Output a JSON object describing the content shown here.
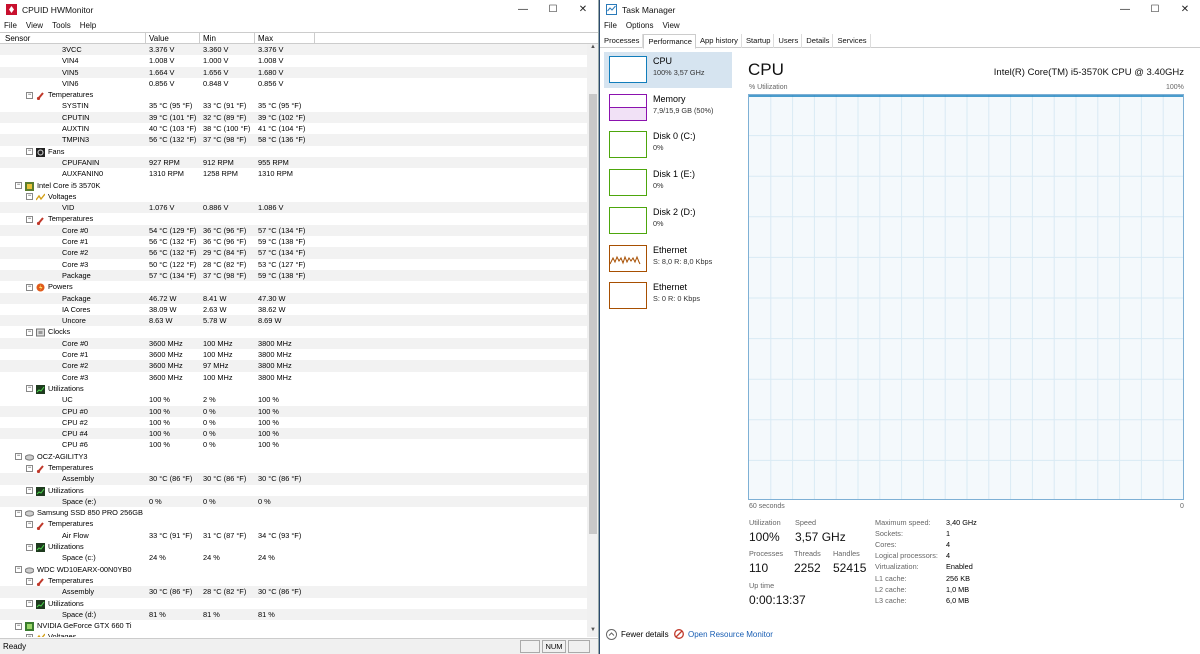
{
  "hwmonitor": {
    "title": "CPUID HWMonitor",
    "menu": [
      "File",
      "View",
      "Tools",
      "Help"
    ],
    "columns": {
      "sensor": "Sensor",
      "value": "Value",
      "min": "Min",
      "max": "Max"
    },
    "status": "Ready",
    "num": "NUM",
    "rows": [
      {
        "t": "leaf",
        "i": 3,
        "n": "3VCC",
        "v": "3.376 V",
        "mn": "3.360 V",
        "mx": "3.376 V"
      },
      {
        "t": "leaf",
        "i": 3,
        "n": "VIN4",
        "v": "1.008 V",
        "mn": "1.000 V",
        "mx": "1.008 V"
      },
      {
        "t": "leaf",
        "i": 3,
        "n": "VIN5",
        "v": "1.664 V",
        "mn": "1.656 V",
        "mx": "1.680 V"
      },
      {
        "t": "leaf",
        "i": 3,
        "n": "VIN6",
        "v": "0.856 V",
        "mn": "0.848 V",
        "mx": "0.856 V"
      },
      {
        "t": "group",
        "i": 2,
        "n": "Temperatures",
        "icon": "thermometer"
      },
      {
        "t": "leaf",
        "i": 3,
        "n": "SYSTIN",
        "v": "35 °C  (95 °F)",
        "mn": "33 °C  (91 °F)",
        "mx": "35 °C  (95 °F)"
      },
      {
        "t": "leaf",
        "i": 3,
        "n": "CPUTIN",
        "v": "39 °C  (101 °F)",
        "mn": "32 °C  (89 °F)",
        "mx": "39 °C  (102 °F)"
      },
      {
        "t": "leaf",
        "i": 3,
        "n": "AUXTIN",
        "v": "40 °C  (103 °F)",
        "mn": "38 °C  (100 °F)",
        "mx": "41 °C  (104 °F)"
      },
      {
        "t": "leaf",
        "i": 3,
        "n": "TMPIN3",
        "v": "56 °C  (132 °F)",
        "mn": "37 °C  (98 °F)",
        "mx": "58 °C  (136 °F)"
      },
      {
        "t": "group",
        "i": 2,
        "n": "Fans",
        "icon": "fan"
      },
      {
        "t": "leaf",
        "i": 3,
        "n": "CPUFANIN",
        "v": "927 RPM",
        "mn": "912 RPM",
        "mx": "955 RPM"
      },
      {
        "t": "leaf",
        "i": 3,
        "n": "AUXFANIN0",
        "v": "1310 RPM",
        "mn": "1258 RPM",
        "mx": "1310 RPM"
      },
      {
        "t": "group",
        "i": 1,
        "n": "Intel Core i5 3570K",
        "icon": "chip"
      },
      {
        "t": "group",
        "i": 2,
        "n": "Voltages",
        "icon": "voltage"
      },
      {
        "t": "leaf",
        "i": 3,
        "n": "VID",
        "v": "1.076 V",
        "mn": "0.886 V",
        "mx": "1.086 V"
      },
      {
        "t": "group",
        "i": 2,
        "n": "Temperatures",
        "icon": "thermometer"
      },
      {
        "t": "leaf",
        "i": 3,
        "n": "Core #0",
        "v": "54 °C  (129 °F)",
        "mn": "36 °C  (96 °F)",
        "mx": "57 °C  (134 °F)"
      },
      {
        "t": "leaf",
        "i": 3,
        "n": "Core #1",
        "v": "56 °C  (132 °F)",
        "mn": "36 °C  (96 °F)",
        "mx": "59 °C  (138 °F)"
      },
      {
        "t": "leaf",
        "i": 3,
        "n": "Core #2",
        "v": "56 °C  (132 °F)",
        "mn": "29 °C  (84 °F)",
        "mx": "57 °C  (134 °F)"
      },
      {
        "t": "leaf",
        "i": 3,
        "n": "Core #3",
        "v": "50 °C  (122 °F)",
        "mn": "28 °C  (82 °F)",
        "mx": "53 °C  (127 °F)"
      },
      {
        "t": "leaf",
        "i": 3,
        "n": "Package",
        "v": "57 °C  (134 °F)",
        "mn": "37 °C  (98 °F)",
        "mx": "59 °C  (138 °F)"
      },
      {
        "t": "group",
        "i": 2,
        "n": "Powers",
        "icon": "power"
      },
      {
        "t": "leaf",
        "i": 3,
        "n": "Package",
        "v": "46.72 W",
        "mn": "8.41 W",
        "mx": "47.30 W"
      },
      {
        "t": "leaf",
        "i": 3,
        "n": "IA Cores",
        "v": "38.09 W",
        "mn": "2.63 W",
        "mx": "38.62 W"
      },
      {
        "t": "leaf",
        "i": 3,
        "n": "Uncore",
        "v": "8.63 W",
        "mn": "5.78 W",
        "mx": "8.69 W"
      },
      {
        "t": "group",
        "i": 2,
        "n": "Clocks",
        "icon": "clock"
      },
      {
        "t": "leaf",
        "i": 3,
        "n": "Core #0",
        "v": "3600 MHz",
        "mn": "100 MHz",
        "mx": "3800 MHz"
      },
      {
        "t": "leaf",
        "i": 3,
        "n": "Core #1",
        "v": "3600 MHz",
        "mn": "100 MHz",
        "mx": "3800 MHz"
      },
      {
        "t": "leaf",
        "i": 3,
        "n": "Core #2",
        "v": "3600 MHz",
        "mn": "97 MHz",
        "mx": "3800 MHz"
      },
      {
        "t": "leaf",
        "i": 3,
        "n": "Core #3",
        "v": "3600 MHz",
        "mn": "100 MHz",
        "mx": "3800 MHz"
      },
      {
        "t": "group",
        "i": 2,
        "n": "Utilizations",
        "icon": "util"
      },
      {
        "t": "leaf",
        "i": 3,
        "n": "UC",
        "v": "100 %",
        "mn": "2 %",
        "mx": "100 %"
      },
      {
        "t": "leaf",
        "i": 3,
        "n": "CPU #0",
        "v": "100 %",
        "mn": "0 %",
        "mx": "100 %"
      },
      {
        "t": "leaf",
        "i": 3,
        "n": "CPU #2",
        "v": "100 %",
        "mn": "0 %",
        "mx": "100 %"
      },
      {
        "t": "leaf",
        "i": 3,
        "n": "CPU #4",
        "v": "100 %",
        "mn": "0 %",
        "mx": "100 %"
      },
      {
        "t": "leaf",
        "i": 3,
        "n": "CPU #6",
        "v": "100 %",
        "mn": "0 %",
        "mx": "100 %"
      },
      {
        "t": "group",
        "i": 1,
        "n": "OCZ-AGILITY3",
        "icon": "disk"
      },
      {
        "t": "group",
        "i": 2,
        "n": "Temperatures",
        "icon": "thermometer"
      },
      {
        "t": "leaf",
        "i": 3,
        "n": "Assembly",
        "v": "30 °C  (86 °F)",
        "mn": "30 °C  (86 °F)",
        "mx": "30 °C  (86 °F)"
      },
      {
        "t": "group",
        "i": 2,
        "n": "Utilizations",
        "icon": "util"
      },
      {
        "t": "leaf",
        "i": 3,
        "n": "Space (e:)",
        "v": "0 %",
        "mn": "0 %",
        "mx": "0 %"
      },
      {
        "t": "group",
        "i": 1,
        "n": "Samsung SSD 850 PRO 256GB",
        "icon": "disk"
      },
      {
        "t": "group",
        "i": 2,
        "n": "Temperatures",
        "icon": "thermometer"
      },
      {
        "t": "leaf",
        "i": 3,
        "n": "Air Flow",
        "v": "33 °C  (91 °F)",
        "mn": "31 °C  (87 °F)",
        "mx": "34 °C  (93 °F)"
      },
      {
        "t": "group",
        "i": 2,
        "n": "Utilizations",
        "icon": "util"
      },
      {
        "t": "leaf",
        "i": 3,
        "n": "Space (c:)",
        "v": "24 %",
        "mn": "24 %",
        "mx": "24 %"
      },
      {
        "t": "group",
        "i": 1,
        "n": "WDC WD10EARX-00N0YB0",
        "icon": "disk"
      },
      {
        "t": "group",
        "i": 2,
        "n": "Temperatures",
        "icon": "thermometer"
      },
      {
        "t": "leaf",
        "i": 3,
        "n": "Assembly",
        "v": "30 °C  (86 °F)",
        "mn": "28 °C  (82 °F)",
        "mx": "30 °C  (86 °F)"
      },
      {
        "t": "group",
        "i": 2,
        "n": "Utilizations",
        "icon": "util"
      },
      {
        "t": "leaf",
        "i": 3,
        "n": "Space (d:)",
        "v": "81 %",
        "mn": "81 %",
        "mx": "81 %"
      },
      {
        "t": "group",
        "i": 1,
        "n": "NVIDIA GeForce GTX 660 Ti",
        "icon": "gpu"
      },
      {
        "t": "group",
        "i": 2,
        "n": "Voltages",
        "icon": "voltage"
      }
    ]
  },
  "taskmanager": {
    "title": "Task Manager",
    "menu": [
      "File",
      "Options",
      "View"
    ],
    "tabs": [
      "Processes",
      "Performance",
      "App history",
      "Startup",
      "Users",
      "Details",
      "Services"
    ],
    "active_tab": "Performance",
    "resources": [
      {
        "name": "CPU",
        "sub": "100% 3,57 GHz",
        "color": "#117dbb",
        "selected": true
      },
      {
        "name": "Memory",
        "sub": "7,9/15,9 GB (50%)",
        "color": "#8b12ae",
        "selected": false
      },
      {
        "name": "Disk 0 (C:)",
        "sub": "0%",
        "color": "#4da60c",
        "selected": false
      },
      {
        "name": "Disk 1 (E:)",
        "sub": "0%",
        "color": "#4da60c",
        "selected": false
      },
      {
        "name": "Disk 2 (D:)",
        "sub": "0%",
        "color": "#4da60c",
        "selected": false
      },
      {
        "name": "Ethernet",
        "sub": "S: 8,0  R: 8,0 Kbps",
        "color": "#a74f01",
        "selected": false
      },
      {
        "name": "Ethernet",
        "sub": "S: 0  R: 0 Kbps",
        "color": "#a74f01",
        "selected": false
      }
    ],
    "cpu": {
      "title": "CPU",
      "model": "Intel(R) Core(TM) i5-3570K CPU @ 3.40GHz",
      "util_label": "% Utilization",
      "util_max": "100%",
      "time_label": "60 seconds",
      "zero": "0",
      "utilization_value": 100,
      "stats": {
        "utilization_label": "Utilization",
        "utilization": "100%",
        "speed_label": "Speed",
        "speed": "3,57 GHz",
        "processes_label": "Processes",
        "processes": "110",
        "threads_label": "Threads",
        "threads": "2252",
        "handles_label": "Handles",
        "handles": "52415",
        "uptime_label": "Up time",
        "uptime": "0:00:13:37"
      },
      "specs": [
        {
          "k": "Maximum speed:",
          "v": "3,40 GHz"
        },
        {
          "k": "Sockets:",
          "v": "1"
        },
        {
          "k": "Cores:",
          "v": "4"
        },
        {
          "k": "Logical processors:",
          "v": "4"
        },
        {
          "k": "Virtualization:",
          "v": "Enabled"
        },
        {
          "k": "L1 cache:",
          "v": "256 KB"
        },
        {
          "k": "L2 cache:",
          "v": "1,0 MB"
        },
        {
          "k": "L3 cache:",
          "v": "6,0 MB"
        }
      ]
    },
    "footer": {
      "fewer": "Fewer details",
      "monitor": "Open Resource Monitor"
    },
    "accent": "#117dbb"
  }
}
